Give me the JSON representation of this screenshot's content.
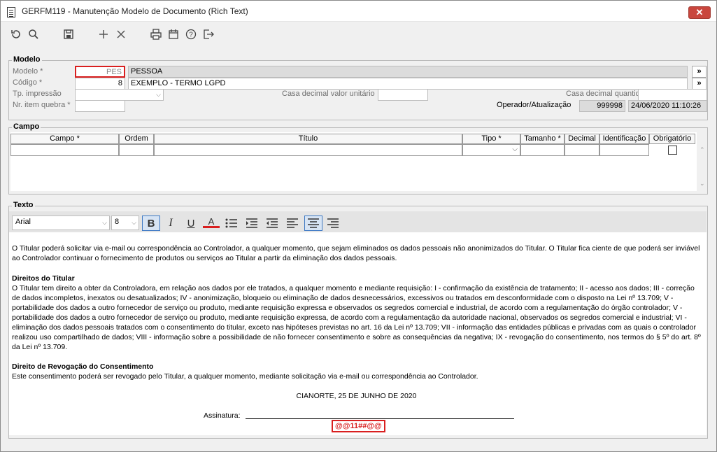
{
  "window": {
    "title": "GERFM119 - Manutenção Modelo de Documento (Rich Text)",
    "close_label": "✕"
  },
  "toolbar": {
    "items": [
      {
        "name": "refresh-icon",
        "glyph": "↺"
      },
      {
        "name": "search-icon",
        "glyph": "🔍"
      },
      {
        "name": "save-icon",
        "glyph": "💾"
      },
      {
        "name": "add-icon",
        "glyph": "+"
      },
      {
        "name": "delete-icon",
        "glyph": "✕"
      },
      {
        "name": "print-icon",
        "glyph": "🖶"
      },
      {
        "name": "calendar-icon",
        "glyph": "📅"
      },
      {
        "name": "help-icon",
        "glyph": "?"
      },
      {
        "name": "exit-icon",
        "glyph": "⇥"
      }
    ]
  },
  "modelo": {
    "group_title": "Modelo",
    "modelo_label": "Modelo *",
    "modelo_value": "PES",
    "modelo_desc": "PESSOA",
    "codigo_label": "Código *",
    "codigo_value": "8",
    "codigo_desc": "EXEMPLO - TERMO LGPD",
    "tp_impressao_label": "Tp. impressão",
    "casa_decimal_valor_label": "Casa decimal valor unitário",
    "casa_decimal_qtd_label": "Casa decimal quantidade",
    "nr_item_quebra_label": "Nr. item quebra *",
    "operador_label": "Operador/Atualização",
    "operador_value": "999998",
    "atualizacao_value": "24/06/2020 11:10:26",
    "lookup_label": "»"
  },
  "campo": {
    "group_title": "Campo",
    "columns": [
      "Campo *",
      "Ordem",
      "Título",
      "Tipo *",
      "Tamanho *",
      "Decimal",
      "Identificação",
      "Obrigatório"
    ]
  },
  "texto": {
    "group_title": "Texto",
    "font_family": "Arial",
    "font_size": "8",
    "bold_label": "B",
    "italic_label": "I",
    "underline_label": "U",
    "color_label": "A",
    "paragraph1": "O Titular poderá solicitar via e-mail ou correspondência ao Controlador, a qualquer momento, que sejam eliminados os dados pessoais não anonimizados do Titular. O Titular fica ciente de que poderá ser inviável ao Controlador continuar o fornecimento de produtos ou serviços ao Titular a partir da eliminação dos dados pessoais.",
    "heading_direitos": "Direitos do Titular",
    "paragraph2": "O Titular tem direito a obter da Controladora, em relação aos dados por ele tratados, a qualquer momento e mediante requisição: I - confirmação da existência de tratamento; II - acesso aos dados; III - correção de dados incompletos, inexatos ou desatualizados; IV - anonimização, bloqueio ou eliminação de dados desnecessários, excessivos ou tratados em desconformidade com o disposto na Lei nº 13.709; V - portabilidade dos dados a outro fornecedor de serviço ou produto, mediante requisição expressa e observados os segredos comercial e industrial, de acordo com a regulamentação do órgão controlador; V - portabilidade dos dados a outro fornecedor de serviço ou produto, mediante requisição expressa, de acordo com a regulamentação da autoridade nacional, observados os segredos comercial e industrial; VI - eliminação dos dados pessoais tratados com o consentimento do titular, exceto nas hipóteses previstas no art. 16 da Lei nº 13.709; VII - informação das entidades públicas e privadas com as quais o controlador realizou uso compartilhado de dados; VIII - informação sobre a possibilidade de não fornecer consentimento e sobre as consequências da negativa; IX - revogação do consentimento, nos termos do § 5º do art. 8º da Lei nº 13.709.",
    "heading_revogacao": "Direito de Revogação do Consentimento",
    "paragraph3": "Este consentimento poderá ser revogado pelo Titular, a qualquer momento, mediante solicitação via e-mail ou correspondência ao Controlador.",
    "date_line": "CIANORTE, 25 DE JUNHO DE 2020",
    "signature_label": "Assinatura:",
    "signature_token": "@@11##@@"
  }
}
